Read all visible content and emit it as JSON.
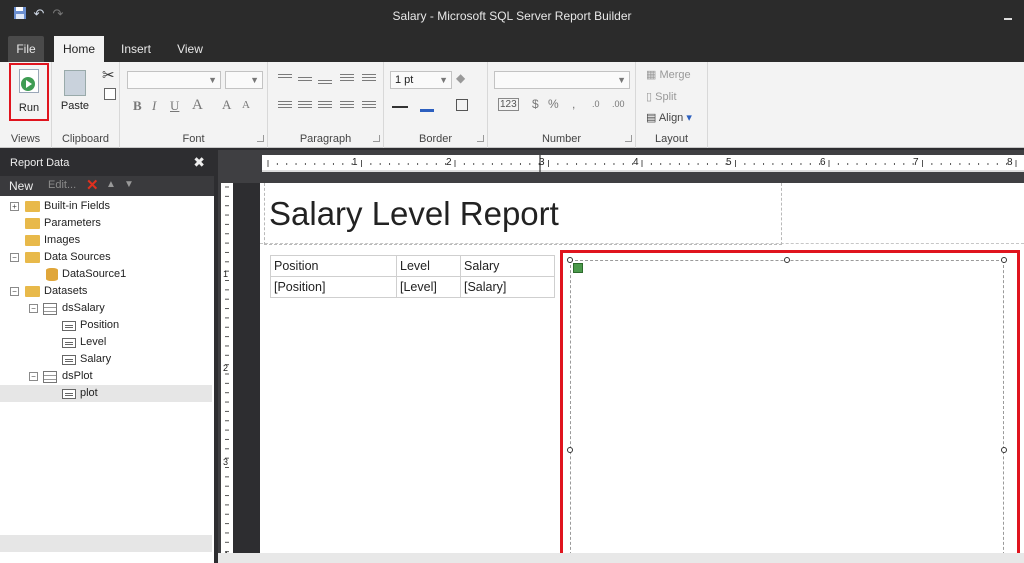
{
  "window": {
    "title": "Salary - Microsoft SQL Server Report Builder"
  },
  "ribbon_tabs": [
    "File",
    "Home",
    "Insert",
    "View"
  ],
  "ribbon": {
    "run_label": "Run",
    "paste_label": "Paste",
    "font_size_value": "1 pt",
    "merge_label": "Merge",
    "split_label": "Split",
    "align_label": "Align",
    "groups": {
      "views": "Views",
      "clipboard": "Clipboard",
      "font": "Font",
      "paragraph": "Paragraph",
      "border": "Border",
      "number": "Number",
      "layout": "Layout"
    }
  },
  "report_data": {
    "title": "Report Data",
    "new_label": "New",
    "edit_label": "Edit...",
    "tree": {
      "built_in_fields": "Built-in Fields",
      "parameters": "Parameters",
      "images": "Images",
      "data_sources": "Data Sources",
      "datasource1": "DataSource1",
      "datasets": "Datasets",
      "ds_salary": "dsSalary",
      "field_position": "Position",
      "field_level": "Level",
      "field_salary": "Salary",
      "ds_plot": "dsPlot",
      "field_plot": "plot"
    }
  },
  "ruler": {
    "h_numbers": [
      "1",
      "2",
      "3",
      "4",
      "5",
      "6",
      "7",
      "8"
    ],
    "v_numbers": [
      "1",
      "2",
      "3",
      "4"
    ]
  },
  "report": {
    "title": "Salary Level Report",
    "table_headers": [
      "Position",
      "Level",
      "Salary"
    ],
    "table_row": [
      "[Position]",
      "[Level]",
      "[Salary]"
    ]
  },
  "colors": {
    "highlight": "#e0141e",
    "chrome_dark": "#2d2d30",
    "ribbon_bg": "#f3f3f3"
  }
}
